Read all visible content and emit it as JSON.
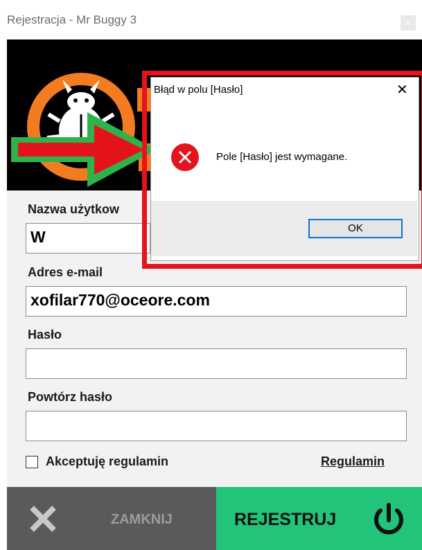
{
  "window": {
    "title": "Rejestracja - Mr Buggy 3",
    "close_glyph": "×"
  },
  "form": {
    "username_label": "Nazwa użytkow",
    "username_value": "W",
    "email_label": "Adres e-mail",
    "email_value": "xofilar770@oceore.com",
    "password_label": "Hasło",
    "password_value": "",
    "repeat_label": "Powtórz hasło",
    "repeat_value": "",
    "accept_label": "Akceptuję regulamin",
    "terms_link": "Regulamin"
  },
  "footer": {
    "close_label": "ZAMKNIJ",
    "register_label": "REJESTRUJ"
  },
  "dialog": {
    "title": "Błąd w polu [Hasło]",
    "message": "Pole [Hasło] jest wymagane.",
    "ok_label": "OK",
    "close_glyph": "✕"
  },
  "icons": {
    "logo": "bug-logo-icon",
    "arrow": "green-red-arrow-icon",
    "error": "error-icon",
    "close_x": "close-x-icon",
    "power": "power-icon"
  },
  "colors": {
    "banner": "#000000",
    "logo_orange": "#f47c20",
    "register_green": "#22c47a",
    "close_gray": "#5a5a5a",
    "error_red": "#e5131b",
    "highlight_red": "#e5131b",
    "ok_border": "#0a73d6"
  }
}
